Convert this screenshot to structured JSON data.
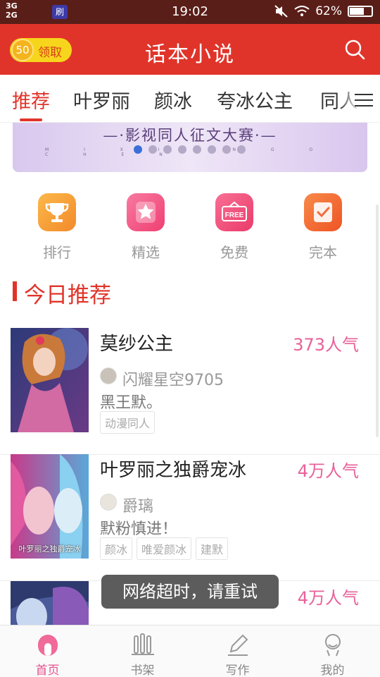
{
  "status_bar": {
    "network_top": "3G",
    "network_bottom": "2G",
    "app_badge": "刷",
    "time": "19:02",
    "battery": "62%"
  },
  "header": {
    "coin_value": "50",
    "coin_label": "领取",
    "title": "话本小说",
    "search_icon": "search-icon"
  },
  "tabs": [
    "推荐",
    "叶罗丽",
    "颜冰",
    "夸冰公主",
    "同人"
  ],
  "banner": {
    "title": "—·影视同人征文大赛·—",
    "subtitle": "M I X I A N G O C H E N"
  },
  "categories": [
    {
      "label": "排行",
      "icon": "trophy-icon",
      "color": "#f7a23a"
    },
    {
      "label": "精选",
      "icon": "star-icon",
      "color": "#f35a86"
    },
    {
      "label": "免费",
      "icon": "free-icon",
      "color": "#f0507a"
    },
    {
      "label": "完本",
      "icon": "check-icon",
      "color": "#f26a3a"
    }
  ],
  "section_title": "今日推荐",
  "books": [
    {
      "title": "莫纱公主",
      "popularity": "373人气",
      "author": "闪耀星空9705",
      "description": "黑王默。",
      "tags": [
        "动漫同人"
      ]
    },
    {
      "title": "叶罗丽之独爵宠冰",
      "popularity": "4万人气",
      "author": "爵璃",
      "description": "默粉慎进！",
      "tags": [
        "颜冰",
        "唯爱颜冰",
        "建默"
      ],
      "cover_caption": "叶罗丽之独爵宠冰"
    },
    {
      "title": "",
      "popularity": "4万人气",
      "author": "",
      "description": "",
      "tags": []
    }
  ],
  "toast": "网络超时，请重试",
  "bottom_nav": [
    {
      "label": "首页",
      "icon": "home-icon",
      "active": true
    },
    {
      "label": "书架",
      "icon": "bookshelf-icon",
      "active": false
    },
    {
      "label": "写作",
      "icon": "pen-icon",
      "active": false
    },
    {
      "label": "我的",
      "icon": "profile-icon",
      "active": false
    }
  ],
  "colors": {
    "brand_red": "#e0342a",
    "popularity_pink": "#e8619a",
    "active_nav": "#e6508c"
  }
}
